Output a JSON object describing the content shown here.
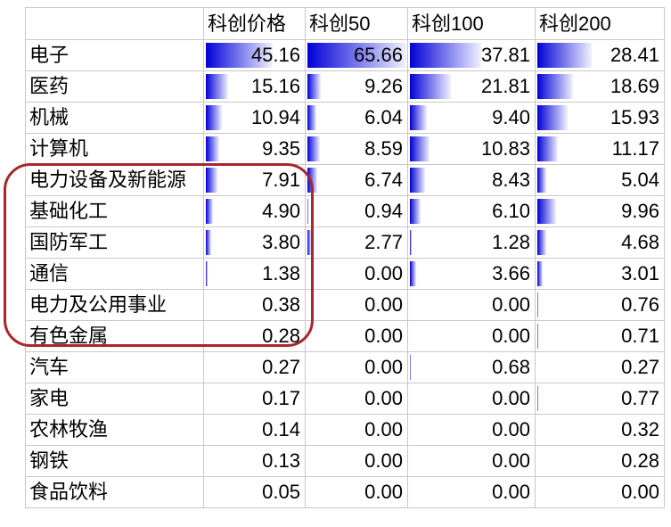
{
  "colors": {
    "grid": "#c8c8c8",
    "bar_start": "#0000d8",
    "bar_end": "#f2f2ff",
    "highlight": "#a8262e"
  },
  "chart_data": {
    "type": "table",
    "data_bars": true,
    "columns": [
      "科创价格",
      "科创50",
      "科创100",
      "科创200"
    ],
    "rows": [
      {
        "label": "电子",
        "values": [
          45.16,
          65.66,
          37.81,
          28.41
        ]
      },
      {
        "label": "医药",
        "values": [
          15.16,
          9.26,
          21.81,
          18.69
        ]
      },
      {
        "label": "机械",
        "values": [
          10.94,
          6.04,
          9.4,
          15.93
        ]
      },
      {
        "label": "计算机",
        "values": [
          9.35,
          8.59,
          10.83,
          11.17
        ]
      },
      {
        "label": "电力设备及新能源",
        "values": [
          7.91,
          6.74,
          8.43,
          5.04
        ],
        "highlighted": true
      },
      {
        "label": "基础化工",
        "values": [
          4.9,
          0.94,
          6.1,
          9.96
        ],
        "highlighted": true
      },
      {
        "label": "国防军工",
        "values": [
          3.8,
          2.77,
          1.28,
          4.68
        ],
        "highlighted": true
      },
      {
        "label": "通信",
        "values": [
          1.38,
          0.0,
          3.66,
          3.01
        ],
        "highlighted": true
      },
      {
        "label": "电力及公用事业",
        "values": [
          0.38,
          0.0,
          0.0,
          0.76
        ],
        "highlighted": true
      },
      {
        "label": "有色金属",
        "values": [
          0.28,
          0.0,
          0.0,
          0.71
        ],
        "highlighted": true
      },
      {
        "label": "汽车",
        "values": [
          0.27,
          0.0,
          0.68,
          0.27
        ]
      },
      {
        "label": "家电",
        "values": [
          0.17,
          0.0,
          0.0,
          0.77
        ]
      },
      {
        "label": "农林牧渔",
        "values": [
          0.14,
          0.0,
          0.0,
          0.32
        ]
      },
      {
        "label": "钢铁",
        "values": [
          0.13,
          0.0,
          0.0,
          0.28
        ]
      },
      {
        "label": "食品饮料",
        "values": [
          0.05,
          0.0,
          0.0,
          0.0
        ]
      }
    ]
  }
}
